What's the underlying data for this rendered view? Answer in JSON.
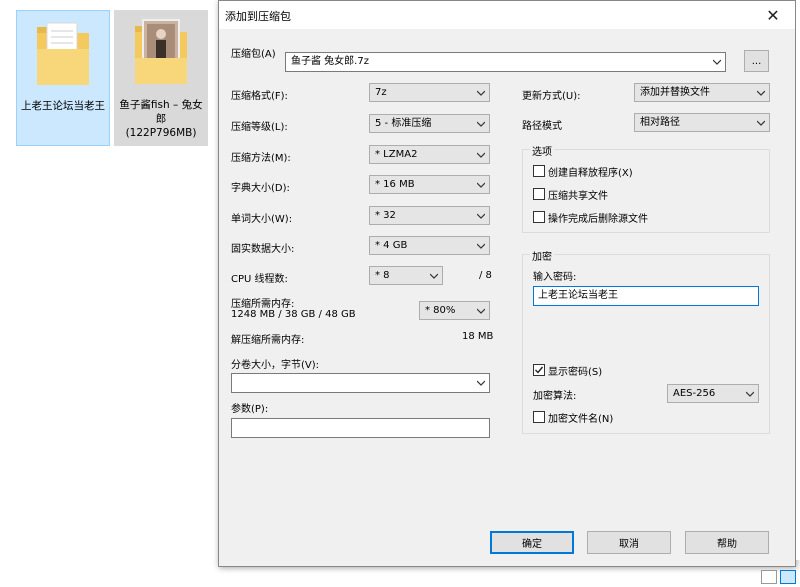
{
  "desktop": {
    "items": [
      {
        "label": "上老王论坛当老王",
        "sub": ""
      },
      {
        "label": "鱼子酱fish – 兔女郎",
        "sub": "(122P796MB)"
      }
    ]
  },
  "dialog": {
    "title": "添加到压缩包",
    "archive": {
      "label": "压缩包(A)",
      "value": "鱼子酱 兔女郎.7z",
      "browse_label": "..."
    },
    "left": {
      "format": {
        "label": "压缩格式(F):",
        "value": "7z"
      },
      "level": {
        "label": "压缩等级(L):",
        "value": "5 - 标准压缩"
      },
      "method": {
        "label": "压缩方法(M):",
        "value": "* LZMA2"
      },
      "dict": {
        "label": "字典大小(D):",
        "value": "* 16 MB"
      },
      "word": {
        "label": "单词大小(W):",
        "value": "* 32"
      },
      "solid": {
        "label": "固实数据大小:",
        "value": "* 4 GB"
      },
      "threads": {
        "label": "CPU 线程数:",
        "value": "* 8",
        "max": "/ 8"
      },
      "mem_comp": {
        "label": "压缩所需内存:",
        "detail": "1248 MB / 38 GB / 48 GB",
        "value": "* 80%"
      },
      "mem_decomp": {
        "label": "解压缩所需内存:",
        "value": "18 MB"
      },
      "volume": {
        "label": "分卷大小，字节(V):",
        "value": ""
      },
      "params": {
        "label": "参数(P):",
        "value": ""
      }
    },
    "right": {
      "update": {
        "label": "更新方式(U):",
        "value": "添加并替换文件"
      },
      "path": {
        "label": "路径模式",
        "value": "相对路径"
      },
      "options": {
        "title": "选项",
        "sfx": {
          "label": "创建自释放程序(X)",
          "checked": false
        },
        "shared": {
          "label": "压缩共享文件",
          "checked": false
        },
        "delete": {
          "label": "操作完成后删除源文件",
          "checked": false
        }
      },
      "encryption": {
        "title": "加密",
        "password_label": "输入密码:",
        "password_value": "上老王论坛当老王",
        "show_password": {
          "label": "显示密码(S)",
          "checked": true
        },
        "method_label": "加密算法:",
        "method_value": "AES-256",
        "encrypt_names": {
          "label": "加密文件名(N)",
          "checked": false
        }
      }
    },
    "buttons": {
      "ok": "确定",
      "cancel": "取消",
      "help": "帮助"
    }
  },
  "colors": {
    "accent": "#0078d7",
    "dialog_bg": "#f0f0f0",
    "selection": "#cce8ff"
  }
}
